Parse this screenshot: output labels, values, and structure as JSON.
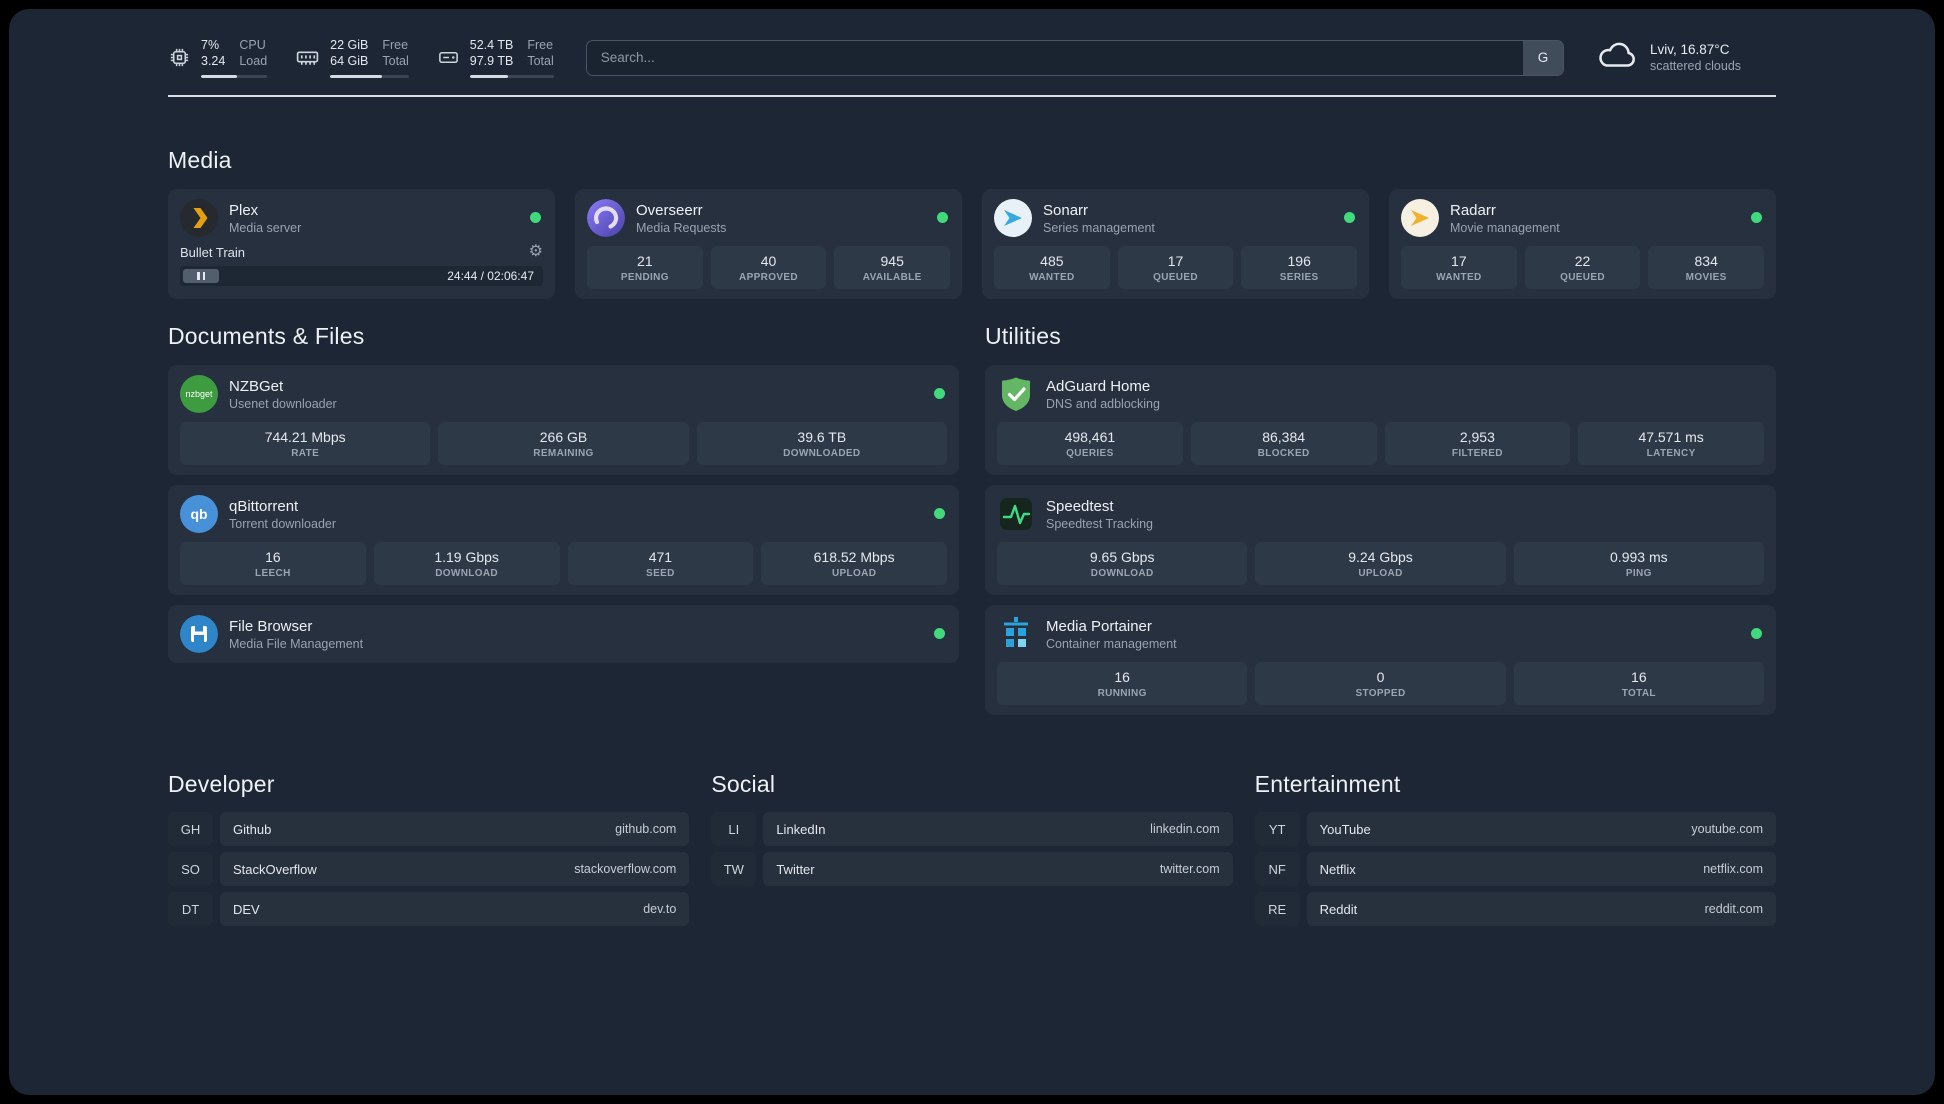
{
  "topbar": {
    "cpu": {
      "icon": "cpu-icon",
      "value": "7%",
      "sub": "3.24",
      "label_top": "CPU",
      "label_bottom": "Load"
    },
    "memory": {
      "icon": "memory-icon",
      "value": "22 GiB",
      "sub": "64 GiB",
      "label_top": "Free",
      "label_bottom": "Total"
    },
    "disk": {
      "icon": "disk-icon",
      "value": "52.4 TB",
      "sub": "97.9 TB",
      "label_top": "Free",
      "label_bottom": "Total"
    },
    "search": {
      "placeholder": "Search...",
      "button_label": "G"
    },
    "weather": {
      "icon": "cloud-icon",
      "location": "Lviv, 16.87°C",
      "condition": "scattered clouds"
    }
  },
  "colors": {
    "status_online": "#41d97c",
    "accent_green": "#3ddc84",
    "plex_gold": "#e5a00d"
  },
  "sections": {
    "media": {
      "title": "Media",
      "apps": [
        {
          "name": "Plex",
          "subtitle": "Media server",
          "icon": "plex-icon",
          "online": true,
          "now_playing": {
            "title": "Bullet Train",
            "time": "24:44 / 02:06:47"
          }
        },
        {
          "name": "Overseerr",
          "subtitle": "Media Requests",
          "icon": "overseerr-icon",
          "online": true,
          "stats": [
            {
              "value": "21",
              "label": "PENDING"
            },
            {
              "value": "40",
              "label": "APPROVED"
            },
            {
              "value": "945",
              "label": "AVAILABLE"
            }
          ]
        },
        {
          "name": "Sonarr",
          "subtitle": "Series management",
          "icon": "sonarr-icon",
          "online": true,
          "stats": [
            {
              "value": "485",
              "label": "WANTED"
            },
            {
              "value": "17",
              "label": "QUEUED"
            },
            {
              "value": "196",
              "label": "SERIES"
            }
          ]
        },
        {
          "name": "Radarr",
          "subtitle": "Movie management",
          "icon": "radarr-icon",
          "online": true,
          "stats": [
            {
              "value": "17",
              "label": "WANTED"
            },
            {
              "value": "22",
              "label": "QUEUED"
            },
            {
              "value": "834",
              "label": "MOVIES"
            }
          ]
        }
      ]
    },
    "documents": {
      "title": "Documents & Files",
      "apps": [
        {
          "name": "NZBGet",
          "subtitle": "Usenet downloader",
          "icon": "nzbget-icon",
          "icon_text": "nzbget",
          "online": true,
          "stats": [
            {
              "value": "744.21 Mbps",
              "label": "RATE"
            },
            {
              "value": "266 GB",
              "label": "REMAINING"
            },
            {
              "value": "39.6 TB",
              "label": "DOWNLOADED"
            }
          ]
        },
        {
          "name": "qBittorrent",
          "subtitle": "Torrent downloader",
          "icon": "qbittorrent-icon",
          "icon_text": "qb",
          "online": true,
          "stats": [
            {
              "value": "16",
              "label": "LEECH"
            },
            {
              "value": "1.19 Gbps",
              "label": "DOWNLOAD"
            },
            {
              "value": "471",
              "label": "SEED"
            },
            {
              "value": "618.52 Mbps",
              "label": "UPLOAD"
            }
          ]
        },
        {
          "name": "File Browser",
          "subtitle": "Media File Management",
          "icon": "filebrowser-icon",
          "online": true,
          "stats": []
        }
      ]
    },
    "utilities": {
      "title": "Utilities",
      "apps": [
        {
          "name": "AdGuard Home",
          "subtitle": "DNS and adblocking",
          "icon": "adguard-shield-icon",
          "online": false,
          "stats": [
            {
              "value": "498,461",
              "label": "QUERIES"
            },
            {
              "value": "86,384",
              "label": "BLOCKED"
            },
            {
              "value": "2,953",
              "label": "FILTERED"
            },
            {
              "value": "47.571 ms",
              "label": "LATENCY"
            }
          ]
        },
        {
          "name": "Speedtest",
          "subtitle": "Speedtest Tracking",
          "icon": "speedtest-pulse-icon",
          "online": false,
          "stats": [
            {
              "value": "9.65 Gbps",
              "label": "DOWNLOAD"
            },
            {
              "value": "9.24 Gbps",
              "label": "UPLOAD"
            },
            {
              "value": "0.993 ms",
              "label": "PING"
            }
          ]
        },
        {
          "name": "Media Portainer",
          "subtitle": "Container management",
          "icon": "portainer-icon",
          "online": true,
          "stats": [
            {
              "value": "16",
              "label": "RUNNING"
            },
            {
              "value": "0",
              "label": "STOPPED"
            },
            {
              "value": "16",
              "label": "TOTAL"
            }
          ]
        }
      ]
    },
    "developer": {
      "title": "Developer",
      "links": [
        {
          "abbr": "GH",
          "name": "Github",
          "url": "github.com"
        },
        {
          "abbr": "SO",
          "name": "StackOverflow",
          "url": "stackoverflow.com"
        },
        {
          "abbr": "DT",
          "name": "DEV",
          "url": "dev.to"
        }
      ]
    },
    "social": {
      "title": "Social",
      "links": [
        {
          "abbr": "LI",
          "name": "LinkedIn",
          "url": "linkedin.com"
        },
        {
          "abbr": "TW",
          "name": "Twitter",
          "url": "twitter.com"
        }
      ]
    },
    "entertainment": {
      "title": "Entertainment",
      "links": [
        {
          "abbr": "YT",
          "name": "YouTube",
          "url": "youtube.com"
        },
        {
          "abbr": "NF",
          "name": "Netflix",
          "url": "netflix.com"
        },
        {
          "abbr": "RE",
          "name": "Reddit",
          "url": "reddit.com"
        }
      ]
    }
  }
}
